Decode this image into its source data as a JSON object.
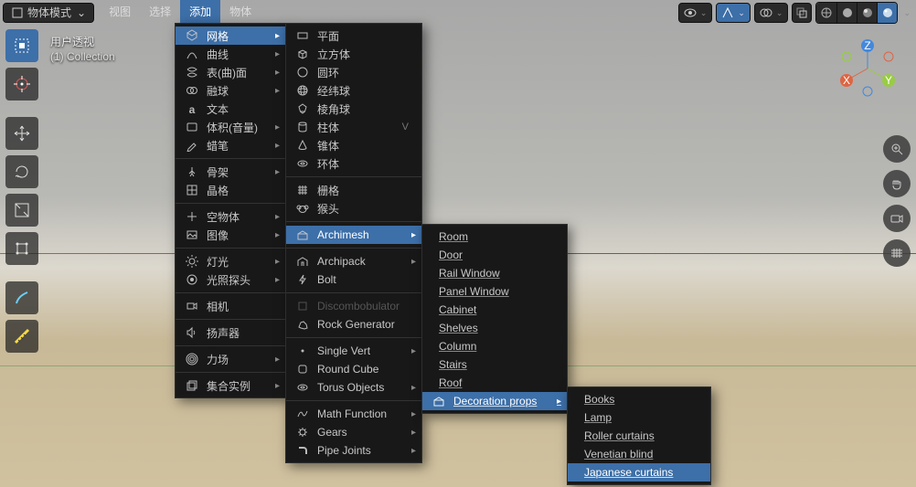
{
  "header": {
    "mode": "物体模式",
    "menus": [
      "视图",
      "选择",
      "添加",
      "物体"
    ]
  },
  "info": {
    "line1": "用户透视",
    "line2": "(1) Collection"
  },
  "add_menu": {
    "groups": [
      [
        {
          "icon": "mesh",
          "label": "网格",
          "sub": true,
          "hl": true
        },
        {
          "icon": "curve",
          "label": "曲线",
          "sub": true
        },
        {
          "icon": "surface",
          "label": "表(曲)面",
          "sub": true
        },
        {
          "icon": "meta",
          "label": "融球",
          "sub": true
        },
        {
          "icon": "text",
          "label": "文本"
        },
        {
          "icon": "volume",
          "label": "体积(音量)",
          "sub": true
        },
        {
          "icon": "gp",
          "label": "蜡笔",
          "sub": true
        }
      ],
      [
        {
          "icon": "arm",
          "label": "骨架",
          "sub": true
        },
        {
          "icon": "lattice",
          "label": "晶格"
        }
      ],
      [
        {
          "icon": "empty",
          "label": "空物体",
          "sub": true
        },
        {
          "icon": "image",
          "label": "图像",
          "sub": true
        }
      ],
      [
        {
          "icon": "light",
          "label": "灯光",
          "sub": true
        },
        {
          "icon": "probe",
          "label": "光照探头",
          "sub": true
        }
      ],
      [
        {
          "icon": "camera",
          "label": "相机"
        }
      ],
      [
        {
          "icon": "speaker",
          "label": "扬声器"
        }
      ],
      [
        {
          "icon": "force",
          "label": "力场",
          "sub": true
        }
      ],
      [
        {
          "icon": "collection",
          "label": "集合实例",
          "sub": true
        }
      ]
    ]
  },
  "mesh_menu": {
    "groups": [
      [
        {
          "icon": "plane",
          "label": "平面"
        },
        {
          "icon": "cube",
          "label": "立方体"
        },
        {
          "icon": "circle",
          "label": "圆环"
        },
        {
          "icon": "uvsphere",
          "label": "经纬球"
        },
        {
          "icon": "icosphere",
          "label": "棱角球"
        },
        {
          "icon": "cylinder",
          "label": "柱体",
          "key": "V"
        },
        {
          "icon": "cone",
          "label": "锥体"
        },
        {
          "icon": "torus",
          "label": "环体"
        }
      ],
      [
        {
          "icon": "grid",
          "label": "栅格"
        },
        {
          "icon": "monkey",
          "label": "猴头"
        }
      ],
      [
        {
          "icon": "archimesh",
          "label": "Archimesh",
          "sub": true,
          "hl": true
        }
      ],
      [
        {
          "icon": "archipack",
          "label": "Archipack",
          "sub": true
        },
        {
          "icon": "bolt",
          "label": "Bolt"
        }
      ],
      [
        {
          "icon": "discomb",
          "label": "Discombobulator",
          "dis": true
        },
        {
          "icon": "rock",
          "label": "Rock Generator"
        }
      ],
      [
        {
          "icon": "vert",
          "label": "Single Vert",
          "sub": true
        },
        {
          "icon": "rcube",
          "label": "Round Cube"
        },
        {
          "icon": "torusobj",
          "label": "Torus Objects",
          "sub": true
        }
      ],
      [
        {
          "icon": "math",
          "label": "Math Function",
          "sub": true
        },
        {
          "icon": "gears",
          "label": "Gears",
          "sub": true
        },
        {
          "icon": "pipe",
          "label": "Pipe Joints",
          "sub": true
        }
      ]
    ]
  },
  "archimesh_menu": {
    "items": [
      {
        "label": "Room",
        "u": "R"
      },
      {
        "label": "Door",
        "u": "D"
      },
      {
        "label": "Rail Window",
        "u": "W"
      },
      {
        "label": "Panel Window",
        "u": "P"
      },
      {
        "label": "Cabinet",
        "u": "C"
      },
      {
        "label": "Shelves",
        "u": "S"
      },
      {
        "label": "Column",
        "u": "o"
      },
      {
        "label": "Stairs",
        "u": "t"
      },
      {
        "label": "Roof",
        "u": "f"
      },
      {
        "label": "Decoration props",
        "sub": true,
        "hl": true,
        "icon": "deco",
        "u": "e"
      }
    ]
  },
  "deco_menu": {
    "items": [
      {
        "label": "Books",
        "u": "B"
      },
      {
        "label": "Lamp",
        "u": "L"
      },
      {
        "label": "Roller curtains",
        "u": "R"
      },
      {
        "label": "Venetian blind",
        "u": "V"
      },
      {
        "label": "Japanese curtains",
        "hl": true,
        "u": "J"
      }
    ]
  }
}
